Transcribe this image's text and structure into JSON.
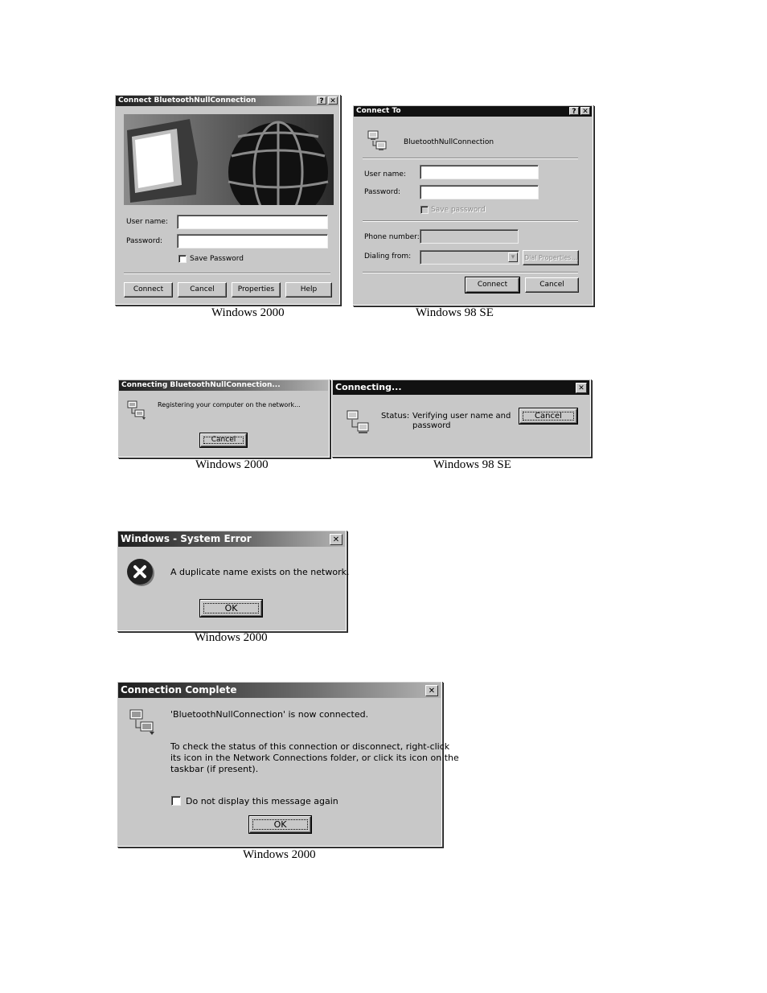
{
  "figures": [
    {
      "caption": "Windows 2000",
      "title": "Connect BluetoothNullConnection",
      "help_btn": "?",
      "close_btn": "✕",
      "user_label": "User name:",
      "password_label": "Password:",
      "save_password_label": "Save Password",
      "buttons": {
        "connect": "Connect",
        "cancel": "Cancel",
        "properties": "Properties",
        "help": "Help"
      }
    },
    {
      "caption": "Windows 98 SE",
      "title": "Connect To",
      "help_btn": "?",
      "close_btn": "✕",
      "connection_name": "BluetoothNullConnection",
      "user_label": "User name:",
      "password_label": "Password:",
      "save_password_label": "Save password",
      "phone_label": "Phone number:",
      "dialing_label": "Dialing from:",
      "dial_properties": "Dial Properties...",
      "buttons": {
        "connect": "Connect",
        "cancel": "Cancel"
      }
    },
    {
      "caption": "Windows 2000",
      "title": "Connecting BluetoothNullConnection...",
      "message": "Registering your computer on the network...",
      "cancel": "Cancel"
    },
    {
      "caption": "Windows 98 SE",
      "title": "Connecting...",
      "close_btn": "✕",
      "status_label": "Status:",
      "status_text_1": "Verifying user name and",
      "status_text_2": "password",
      "cancel": "Cancel"
    },
    {
      "caption": "Windows 2000",
      "title": "Windows - System Error",
      "close_btn": "✕",
      "message": "A duplicate name exists on the network.",
      "ok": "OK"
    },
    {
      "caption": "Windows 2000",
      "title": "Connection Complete",
      "close_btn": "✕",
      "line1": "'BluetoothNullConnection' is now connected.",
      "line2": "To check the status of this connection or disconnect, right-click",
      "line3": "its icon in the Network Connections folder, or click its icon on the",
      "line4": "taskbar (if present).",
      "checkbox_label": "Do not display this message again",
      "ok": "OK"
    }
  ]
}
